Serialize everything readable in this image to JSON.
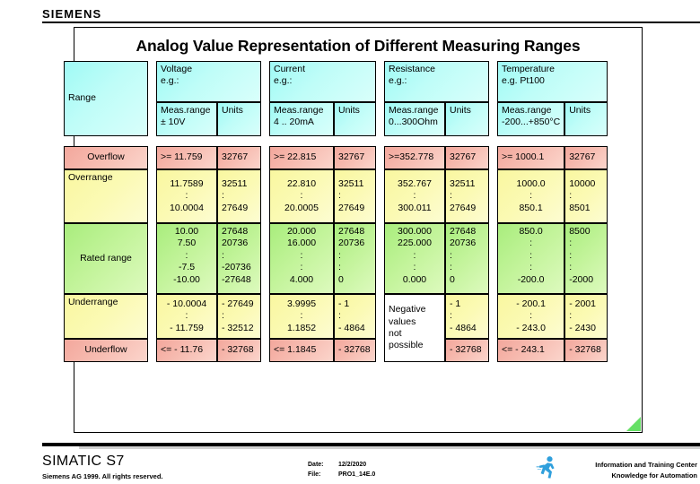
{
  "brand": {
    "name": "SIEMENS"
  },
  "slide": {
    "title": "Analog Value Representation of Different Measuring Ranges"
  },
  "table": {
    "corner_label": "Range",
    "groups": [
      {
        "title": "Voltage",
        "subtitle": "e.g.:",
        "meas_label": "Meas.range",
        "meas_sub": "± 10V",
        "units_label": "Units"
      },
      {
        "title": "Current",
        "subtitle": "e.g.:",
        "meas_label": "Meas.range",
        "meas_sub": "4 .. 20mA",
        "units_label": "Units"
      },
      {
        "title": "Resistance",
        "subtitle": "e.g.:",
        "meas_label": "Meas.range",
        "meas_sub": "0...300Ohm",
        "units_label": "Units"
      },
      {
        "title": "Temperature",
        "subtitle": "e.g.  Pt100",
        "meas_label": "Meas.range",
        "meas_sub": "-200...+850°C",
        "units_label": "Units"
      }
    ],
    "rows": {
      "overflow": {
        "label": "Overflow",
        "voltage_meas": ">= 11.759",
        "voltage_units": "32767",
        "current_meas": ">= 22.815",
        "current_units": "32767",
        "resistance_meas": ">=352.778",
        "resistance_units": "32767",
        "temperature_meas": ">= 1000.1",
        "temperature_units": "32767"
      },
      "overrange": {
        "label": "Overrange",
        "voltage_meas": "11.7589\n:\n10.0004",
        "voltage_units": "32511\n:\n27649",
        "current_meas": "22.810\n:\n20.0005",
        "current_units": "32511\n:\n27649",
        "resistance_meas": "352.767\n:\n300.011",
        "resistance_units": "32511\n:\n27649",
        "temperature_meas": "1000.0\n:\n850.1",
        "temperature_units": "10000\n:\n8501"
      },
      "rated": {
        "label": "Rated range",
        "voltage_meas": "10.00\n  7.50\n:\n-7.5\n-10.00",
        "voltage_units": "27648\n20736\n:\n-20736\n-27648",
        "current_meas": "20.000\n16.000\n:\n:\n4.000",
        "current_units": "27648\n20736\n:\n:\n0",
        "resistance_meas": "300.000\n225.000\n:\n:\n0.000",
        "resistance_units": "27648\n20736\n:\n:\n0",
        "temperature_meas": "850.0\n:\n:\n:\n-200.0",
        "temperature_units": "8500\n:\n:\n:\n-2000"
      },
      "underrange": {
        "label": "Underrange",
        "voltage_meas": "- 10.0004\n:\n- 11.759",
        "voltage_units": "- 27649\n:\n- 32512",
        "current_meas": "3.9995\n:\n1.1852",
        "current_units": "- 1\n:\n- 4864",
        "resistance_meas": "Negative\nvalues\nnot\npossible",
        "resistance_units": "- 1\n:\n- 4864",
        "temperature_meas": "- 200.1\n:\n- 243.0",
        "temperature_units": "- 2001\n:\n- 2430"
      },
      "underflow": {
        "label": "Underflow",
        "voltage_meas": "<= - 11.76",
        "voltage_units": "- 32768",
        "current_meas": "<= 1.1845",
        "current_units": "- 32768",
        "resistance_units": "- 32768",
        "temperature_meas": "<= - 243.1",
        "temperature_units": "- 32768"
      }
    }
  },
  "footer": {
    "product": "SIMATIC S7",
    "copyright": "Siemens AG 1999. All rights reserved.",
    "date_label": "Date:",
    "date_value": "12/2/2020",
    "file_label": "File:",
    "file_value": "PRO1_14E.0",
    "itc_line1": "Information and Training Center",
    "itc_line2": "Knowledge for Automation"
  },
  "colors": {
    "header_cyan": "#9ffaf5",
    "overflow_red": "#f3a79c",
    "range_yellow": "#f9f7a0",
    "rated_green": "#a9ed7d",
    "accent_blue": "#2f9fdc"
  }
}
